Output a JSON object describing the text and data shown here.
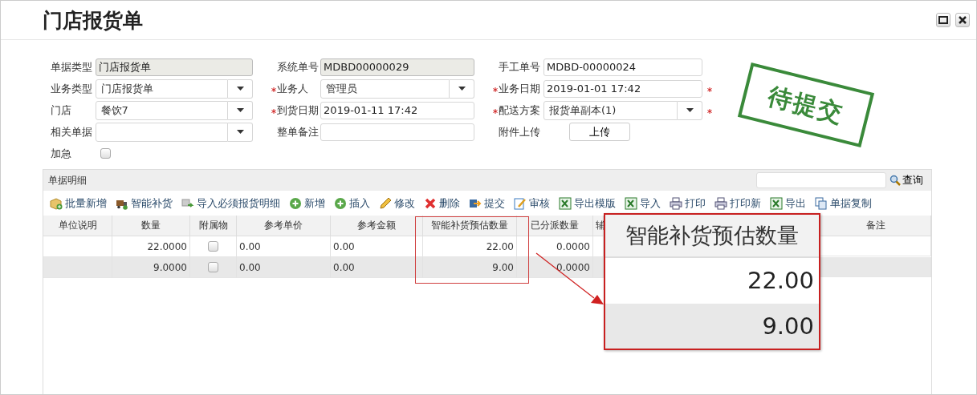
{
  "window": {
    "title": "门店报货单"
  },
  "form": {
    "fields": [
      {
        "label": "单据类型",
        "kind": "readonly",
        "value": "门店报货单",
        "required": false,
        "star_after": false
      },
      {
        "label": "系统单号",
        "kind": "readonly",
        "value": "MDBD00000029",
        "required": false,
        "star_after": false
      },
      {
        "label": "手工单号",
        "kind": "text",
        "value": "MDBD-00000024",
        "required": false,
        "star_after": false
      },
      {
        "label": "业务类型",
        "kind": "select",
        "value": "门店报货单",
        "required": false,
        "star_after": false
      },
      {
        "label": "业务人",
        "kind": "select",
        "value": "管理员",
        "required": true,
        "star_after": false
      },
      {
        "label": "业务日期",
        "kind": "text",
        "value": "2019-01-01 17:42",
        "required": true,
        "star_after": true
      },
      {
        "label": "门店",
        "kind": "select",
        "value": "餐饮7",
        "required": false,
        "star_after": false
      },
      {
        "label": "到货日期",
        "kind": "text",
        "value": "2019-01-11 17:42",
        "required": true,
        "star_after": false
      },
      {
        "label": "配送方案",
        "kind": "select",
        "value": "报货单副本(1)",
        "required": true,
        "star_after": true
      },
      {
        "label": "相关单据",
        "kind": "select",
        "required": false,
        "star_after": false
      },
      {
        "label": "整单备注",
        "kind": "text",
        "required": false,
        "star_after": false
      },
      {
        "label": "附件上传",
        "kind": "button",
        "value": "上传",
        "required": false,
        "star_after": false
      },
      {
        "label": "加急",
        "kind": "checkbox",
        "checked": false,
        "required": false,
        "star_after": false
      }
    ]
  },
  "stamp": {
    "text": "待提交"
  },
  "detail": {
    "title": "单据明细",
    "search_button": "查询",
    "toolbar": [
      {
        "kind": "batch",
        "label": "批量新增"
      },
      {
        "kind": "truck",
        "label": "智能补货"
      },
      {
        "kind": "import",
        "label": "导入必须报货明细"
      },
      {
        "kind": "add",
        "label": "新增"
      },
      {
        "kind": "add",
        "label": "插入"
      },
      {
        "kind": "edit",
        "label": "修改"
      },
      {
        "kind": "delete",
        "label": "删除"
      },
      {
        "kind": "submit",
        "label": "提交"
      },
      {
        "kind": "review",
        "label": "审核"
      },
      {
        "kind": "excel",
        "label": "导出模版"
      },
      {
        "kind": "excel",
        "label": "导入"
      },
      {
        "kind": "print",
        "label": "打印"
      },
      {
        "kind": "print",
        "label": "打印新"
      },
      {
        "kind": "excel",
        "label": "导出"
      },
      {
        "kind": "copy",
        "label": "单据复制"
      }
    ],
    "columns": [
      "单位说明",
      "数量",
      "附属物",
      "参考单价",
      "参考金额",
      "智能补货预估数量",
      "已分派数量",
      "辅",
      "备注"
    ],
    "rows": [
      {
        "selected": false,
        "quantity": "22.0000",
        "attachment_checked": false,
        "ref_price": "0.00",
        "ref_amount": "0.00",
        "smart_estimate": "22.00",
        "dispatched": "0.0000"
      },
      {
        "selected": true,
        "quantity": "9.0000",
        "attachment_checked": false,
        "ref_price": "0.00",
        "ref_amount": "0.00",
        "smart_estimate": "9.00",
        "dispatched": "0.0000"
      }
    ]
  },
  "callout": {
    "header": "智能补货预估数量",
    "values": [
      "22.00",
      "9.00"
    ]
  }
}
